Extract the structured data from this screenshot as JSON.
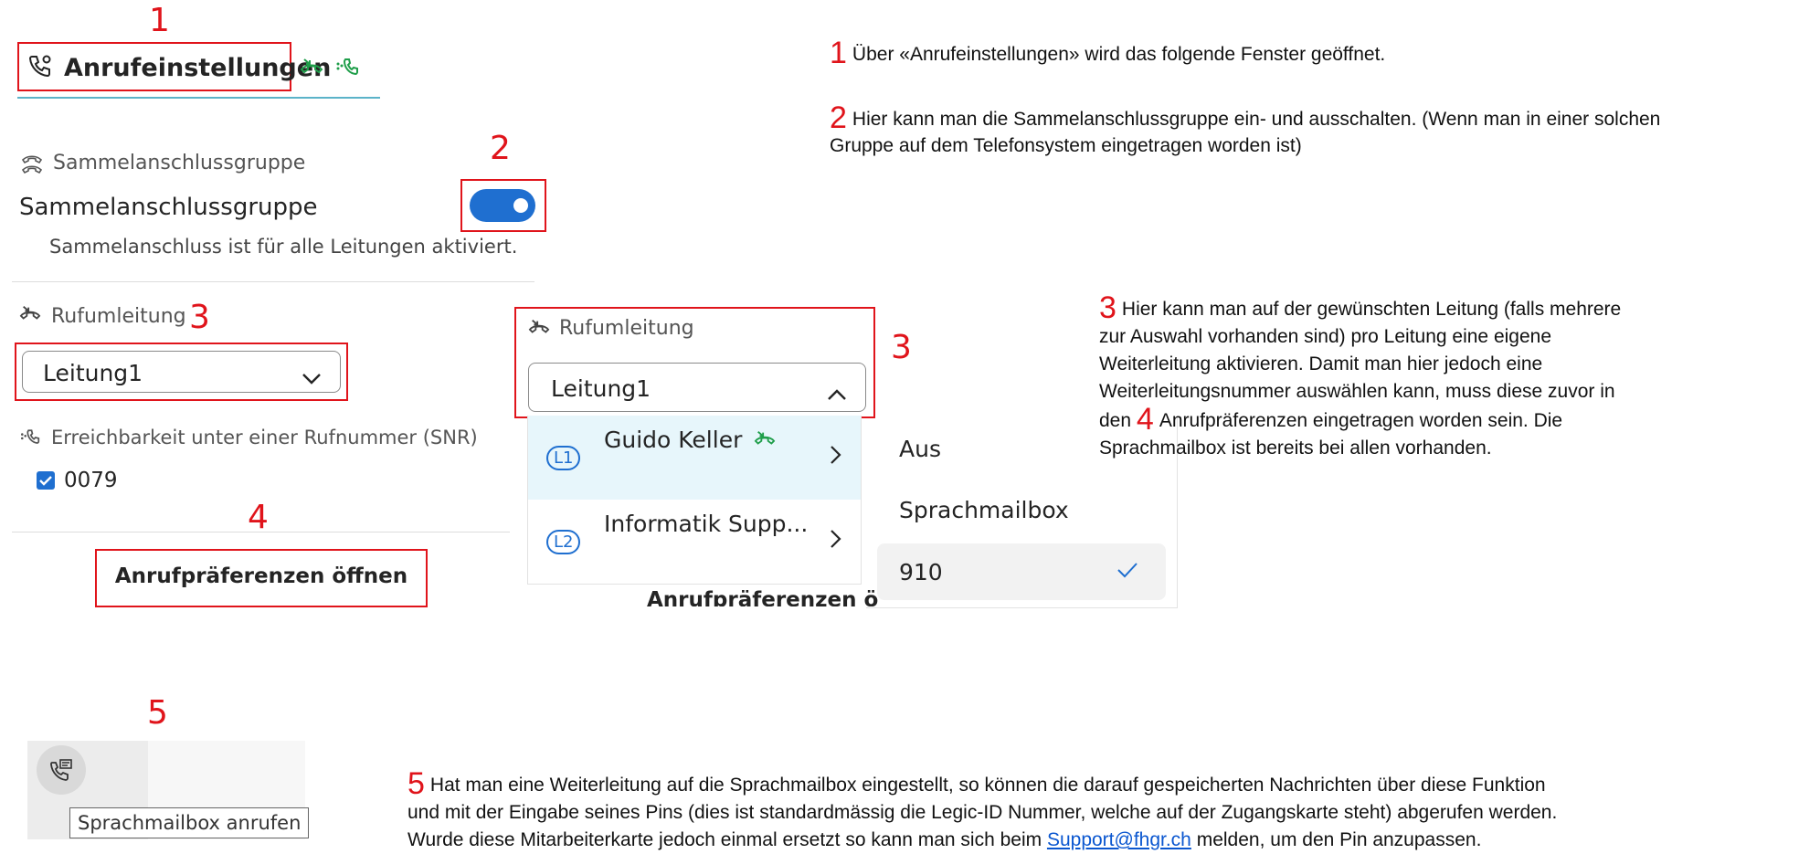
{
  "markers": {
    "m1": "1",
    "m2": "2",
    "m3a": "3",
    "m3b": "3",
    "m4": "4",
    "m5": "5"
  },
  "settings": {
    "title": "Anrufeinstellungen",
    "group_section_label": "Sammelanschlussgruppe",
    "group_toggle_label": "Sammelanschlussgruppe",
    "group_toggle_on": true,
    "group_status": "Sammelanschluss ist für alle Leitungen aktiviert.",
    "forward_section_label": "Rufumleitung",
    "line_select_value": "Leitung1",
    "snr_label": "Erreichbarkeit unter einer Rufnummer (SNR)",
    "snr_number": "0079",
    "preferences_button": "Anrufpräferenzen öffnen"
  },
  "popup": {
    "section_label": "Rufumleitung",
    "select_value": "Leitung1",
    "lines": [
      {
        "badge": "L1",
        "name": "Guido Keller"
      },
      {
        "badge": "L2",
        "name": "Informatik Supp..."
      }
    ],
    "options": [
      "Aus",
      "Sprachmailbox",
      "910"
    ],
    "selected_option": "910",
    "cut_button_text": "Anrufpräferenzen ö"
  },
  "voicemail": {
    "tooltip": "Sprachmailbox anrufen"
  },
  "notes": {
    "n1": "Über «Anrufeinstellungen» wird das folgende Fenster geöffnet.",
    "n2_line1": "Hier kann man die Sammelanschlussgruppe ein- und ausschalten. (Wenn man in einer solchen",
    "n2_line2": "Gruppe auf dem Telefonsystem eingetragen worden ist)",
    "n3_line1": "Hier kann man auf der gewünschten Leitung (falls mehrere",
    "n3_line2": "zur Auswahl vorhanden sind) pro Leitung eine eigene",
    "n3_line3": "Weiterleitung aktivieren. Damit man hier jedoch eine",
    "n3_line4": "Weiterleitungsnummer auswählen kann, muss diese zuvor in",
    "n3_line5_pre": "den",
    "n3_line5_post": "Anrufpräferenzen eingetragen worden sein. Die",
    "n3_line6": "Sprachmailbox ist bereits bei allen vorhanden.",
    "n5_line1": "Hat man eine Weiterleitung auf die Sprachmailbox eingestellt, so können die darauf gespeicherten Nachrichten über diese Funktion",
    "n5_line2": "und mit der Eingabe seines Pins (dies ist standardmässig die Legic-ID Nummer, welche auf der Zugangskarte steht) abgerufen werden.",
    "n5_line3_pre": "Wurde diese Mitarbeiterkarte jedoch einmal ersetzt so kann man sich beim",
    "n5_link": "Support@fhgr.ch",
    "n5_line3_post": "melden, um den Pin anzupassen."
  },
  "colors": {
    "accent": "#1f6fd0",
    "marker": "#e0141b",
    "icon_green": "#1f9e4a",
    "selected_row": "#e7f6fb"
  }
}
